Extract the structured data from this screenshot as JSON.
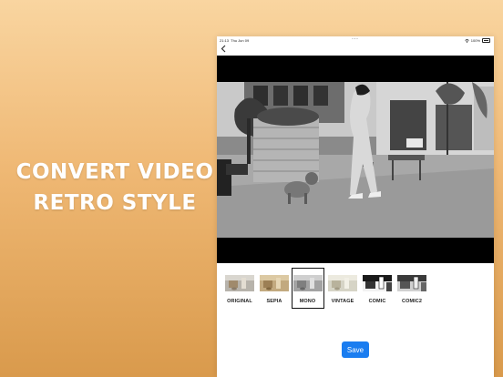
{
  "promo": {
    "line1": "CONVERT VIDEO",
    "line2": "RETRO STYLE"
  },
  "status_bar": {
    "time": "21:13",
    "date": "Thu Jun 09",
    "battery": "100%"
  },
  "icons": {
    "back": "chevron-left-icon",
    "wifi": "wifi-icon",
    "battery": "battery-icon"
  },
  "filters": [
    {
      "label": "ORIGINAL",
      "selected": false
    },
    {
      "label": "SEPIA",
      "selected": false
    },
    {
      "label": "MONO",
      "selected": true
    },
    {
      "label": "VINTAGE",
      "selected": false
    },
    {
      "label": "COMIC",
      "selected": false
    },
    {
      "label": "COMIC2",
      "selected": false
    }
  ],
  "actions": {
    "save_label": "Save"
  },
  "colors": {
    "accent": "#1a7df0",
    "background_top": "#f9d5a0",
    "background_bottom": "#d99a4c"
  }
}
